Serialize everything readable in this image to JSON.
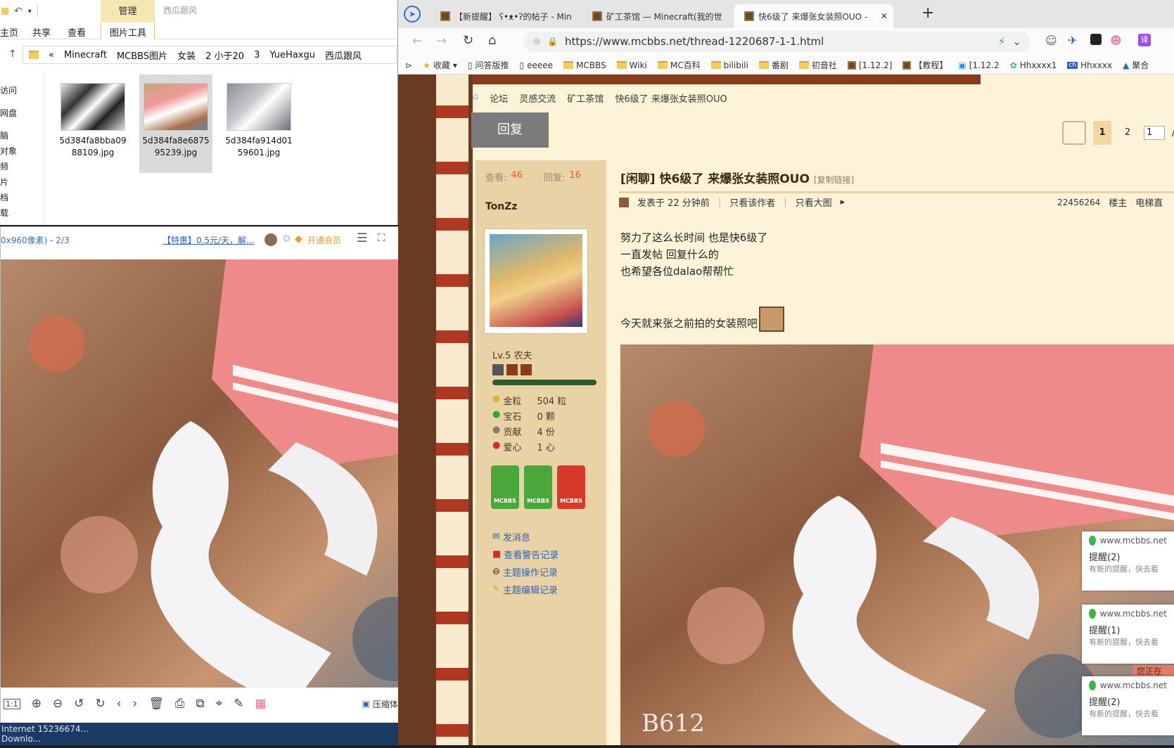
{
  "explorer": {
    "ctx_tab": "管理",
    "ctx_name": "西瓜跟风",
    "ribbon_tabs": [
      "主页",
      "共享",
      "查看",
      "图片工具"
    ],
    "address": [
      "«",
      "Minecraft",
      "MCBBS图片",
      "女装",
      "2 小于20",
      "3",
      "YueHaxgu",
      "西瓜跟风"
    ],
    "nav_items": [
      "访问",
      "网盘",
      "脑",
      "对象",
      "频",
      "片",
      "档",
      "载"
    ],
    "files": [
      {
        "line1": "5d384fa8bba09",
        "line2": "88109.jpg"
      },
      {
        "line1": "5d384fa8e6875",
        "line2": "95239.jpg"
      },
      {
        "line1": "5d384fa914d01",
        "line2": "59601.jpg"
      }
    ]
  },
  "viewer": {
    "title_info": "0x960像素) - 2/3",
    "promo": "【特惠】0.5元/天，解...",
    "vip": "开通会员",
    "compress": "压缩体积",
    "taskbar_line1": "Internet    15236674...",
    "taskbar_line2": "Downlo..."
  },
  "browser": {
    "tabs": [
      {
        "label": "【新提醒】 ʕ•ᴥ•ʔ的帖子 - Min"
      },
      {
        "label": "矿工茶馆 — Minecraft(我的世"
      },
      {
        "label": "快6级了 来爆张女装照OUO - "
      }
    ],
    "url": "https://www.mcbbs.net/thread-1220687-1-1.html",
    "bookmarks": [
      "收藏",
      "问答版推",
      "eeeee",
      "MCBBS",
      "Wiki",
      "MC百科",
      "bilibili",
      "番剧",
      "初音社",
      "[1.12.2]",
      "【教程】",
      "[1.12.2",
      "Hhxxxx1",
      "Hhxxxx",
      "聚合"
    ]
  },
  "page": {
    "breadcrumb": [
      "论坛",
      "灵感交流",
      "矿工茶馆",
      "快6级了 来爆张女装照OUO"
    ],
    "reply_button": "回复",
    "pager": {
      "current": "1",
      "next": "2",
      "input": "1",
      "slash": "/"
    },
    "stats_views_label": "查看:",
    "stats_views": "46",
    "stats_replies_label": "回复:",
    "stats_replies": "16",
    "author": "TonZz",
    "level": "Lv.5 农夫",
    "profile": [
      {
        "label": "金粒",
        "value": "504 粒"
      },
      {
        "label": "宝石",
        "value": "0 颗"
      },
      {
        "label": "贡献",
        "value": "4 份"
      },
      {
        "label": "爱心",
        "value": "1 心"
      }
    ],
    "badge_text": "MCBBS",
    "links": [
      "发消息",
      "查看警告记录",
      "主题操作记录",
      "主题编辑记录"
    ],
    "title": "[闲聊] 快6级了 来爆张女装照OUO",
    "copy_link": "[复制链接]",
    "meta": {
      "posted": "发表于 22 分钟前",
      "only_author": "只看该作者",
      "only_big": "只看大图",
      "uid": "22456264",
      "floor": "楼主",
      "elevator": "电梯直"
    },
    "body_lines": [
      "努力了这么长时间 也是快6级了",
      "一直发帖 回复什么的",
      "也希望各位dalao帮帮忙",
      "",
      "今天就来张之前拍的女装照吧"
    ],
    "watermark": "B612"
  },
  "toasts": [
    {
      "site": "www.mcbbs.net",
      "title": "提醒(2)",
      "sub": "有新的提醒，快去看"
    },
    {
      "site": "www.mcbbs.net",
      "title": "提醒(1)",
      "sub": "有新的提醒，快去看"
    },
    {
      "site": "www.mcbbs.net",
      "title": "提醒(2)",
      "sub": "有新的提醒，快去看"
    }
  ],
  "toast_peek": "您正在"
}
